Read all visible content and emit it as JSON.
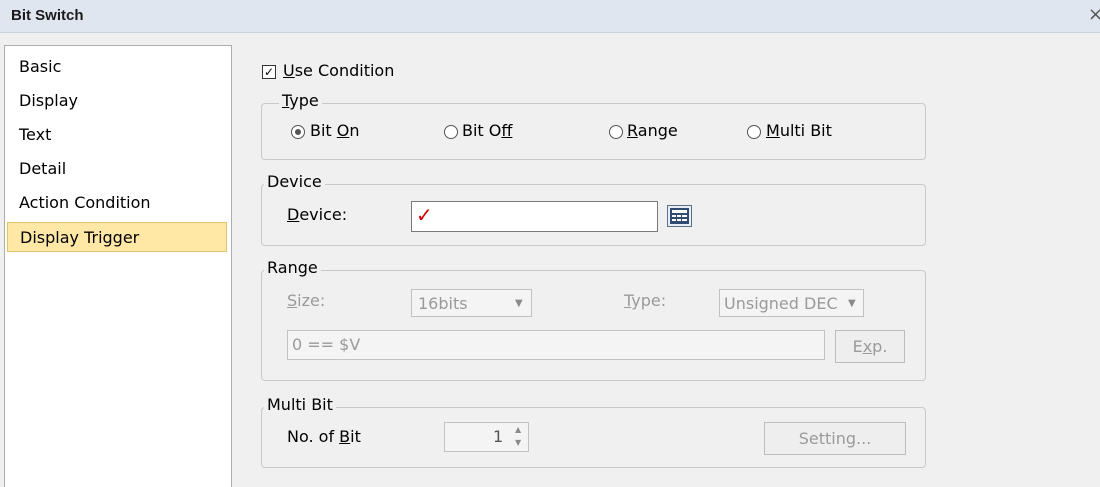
{
  "window": {
    "title": "Bit Switch",
    "close_glyph": "×"
  },
  "nav": {
    "items": [
      {
        "label": "Basic"
      },
      {
        "label": "Display"
      },
      {
        "label": "Text"
      },
      {
        "label": "Detail"
      },
      {
        "label": "Action Condition"
      },
      {
        "label": "Display Trigger",
        "selected": true
      }
    ]
  },
  "use_condition": {
    "checked": true,
    "check_glyph": "✓",
    "hotkey": "U",
    "label_rest": "se Condition"
  },
  "type_group": {
    "label_hotkey": "T",
    "label_rest": "ype",
    "options": [
      {
        "pre": "Bit ",
        "hotkey": "O",
        "post": "n",
        "selected": true
      },
      {
        "pre": "Bit O",
        "hotkey": "f",
        "post": "f",
        "selected": false
      },
      {
        "pre": "",
        "hotkey": "R",
        "post": "ange",
        "selected": false
      },
      {
        "pre": "",
        "hotkey": "M",
        "post": "ulti Bit",
        "selected": false
      }
    ]
  },
  "device_group": {
    "label": "Device",
    "field_hotkey": "D",
    "field_rest": "evice:",
    "value": "",
    "marker": "✓",
    "browse_icon": "address-book-icon"
  },
  "range_group": {
    "label": "Range",
    "size_hotkey": "S",
    "size_rest": "ize:",
    "size_value": "16bits",
    "type_hotkey": "T",
    "type_rest": "ype:",
    "type_value": "Unsigned DEC",
    "expression": "0 == $V",
    "exp_pre": "E",
    "exp_hotkey": "x",
    "exp_post": "p."
  },
  "multibit_group": {
    "label": "Multi Bit",
    "count_pre": "No. of ",
    "count_hotkey": "B",
    "count_post": "it",
    "count_value": "1",
    "setting_label": "Setting..."
  },
  "colors": {
    "selected_bg": "#ffe8a6",
    "marker": "#cc0000"
  }
}
